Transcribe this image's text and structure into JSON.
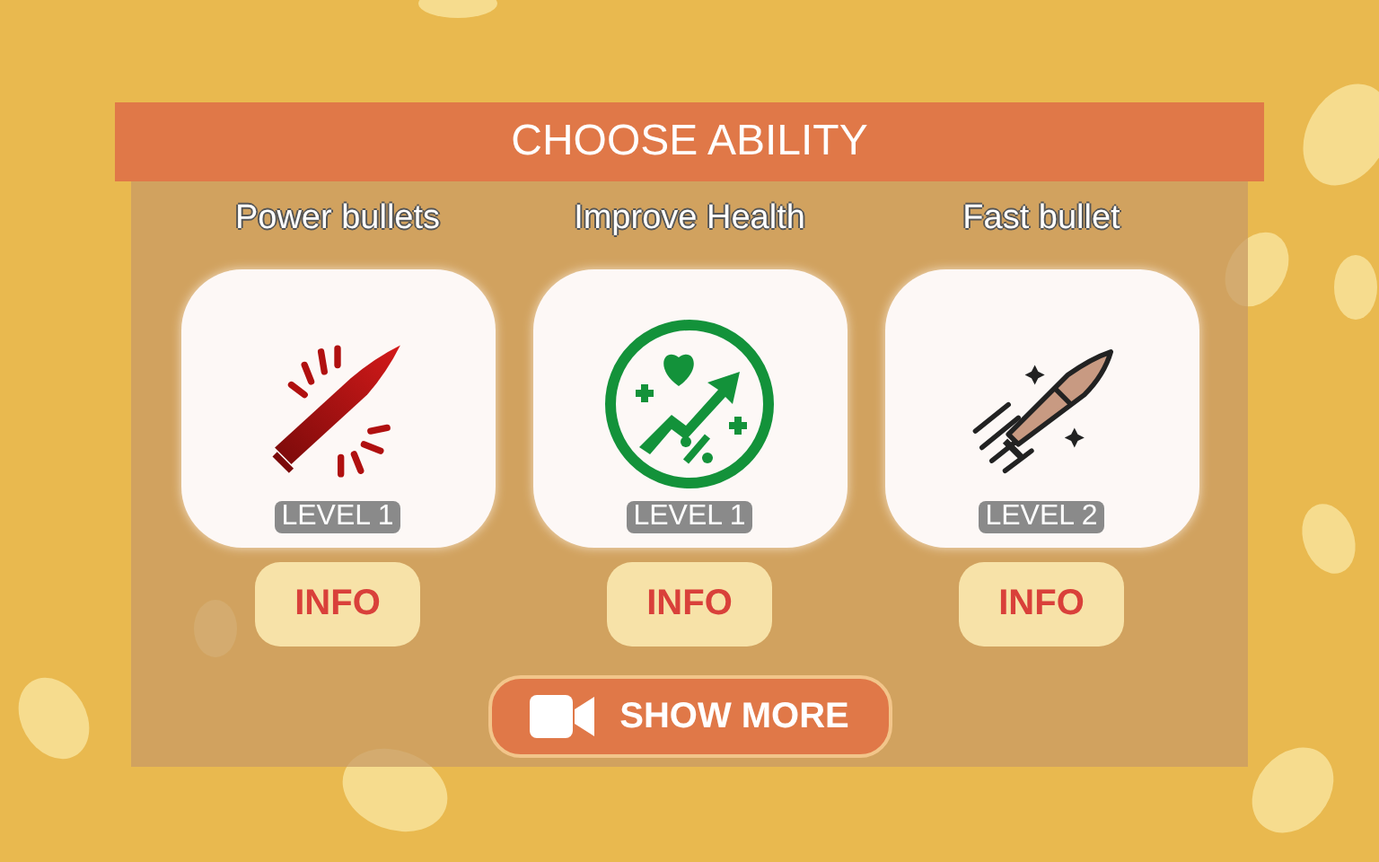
{
  "header": {
    "title": "CHOOSE ABILITY"
  },
  "abilities": [
    {
      "name": "Power bullets",
      "level": "LEVEL 1",
      "button": "INFO"
    },
    {
      "name": "Improve Health",
      "level": "LEVEL 1",
      "button": "INFO"
    },
    {
      "name": "Fast bullet",
      "level": "LEVEL 2",
      "button": "INFO"
    }
  ],
  "show_more": {
    "label": "SHOW MORE"
  }
}
